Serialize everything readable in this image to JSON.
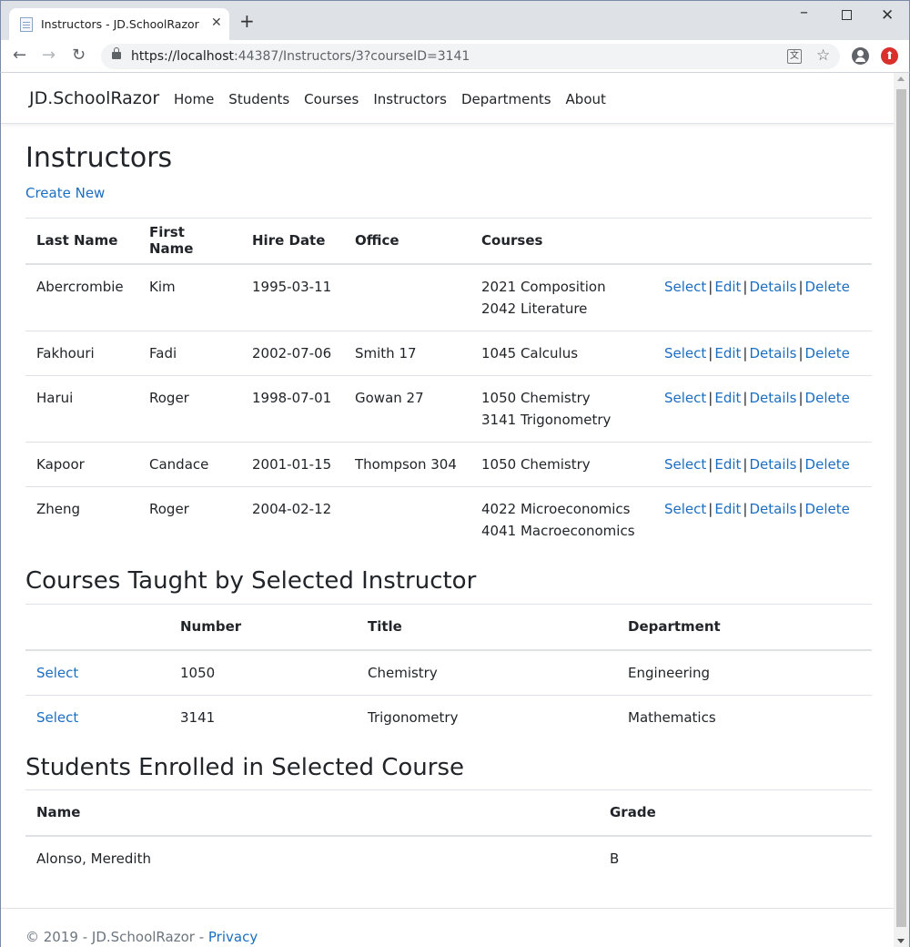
{
  "browser": {
    "tab_title": "Instructors - JD.SchoolRazor",
    "url_host": "https://localhost",
    "url_rest": ":44387/Instructors/3?courseID=3141"
  },
  "nav": {
    "brand": "JD.SchoolRazor",
    "links": [
      "Home",
      "Students",
      "Courses",
      "Instructors",
      "Departments",
      "About"
    ]
  },
  "page": {
    "title": "Instructors",
    "create_new": "Create New"
  },
  "instructors": {
    "headers": [
      "Last Name",
      "First Name",
      "Hire Date",
      "Office",
      "Courses"
    ],
    "actions": [
      "Select",
      "Edit",
      "Details",
      "Delete"
    ],
    "rows": [
      {
        "last": "Abercrombie",
        "first": "Kim",
        "hire": "1995-03-11",
        "office": "",
        "courses": [
          "2021 Composition",
          "2042 Literature"
        ]
      },
      {
        "last": "Fakhouri",
        "first": "Fadi",
        "hire": "2002-07-06",
        "office": "Smith 17",
        "courses": [
          "1045 Calculus"
        ]
      },
      {
        "last": "Harui",
        "first": "Roger",
        "hire": "1998-07-01",
        "office": "Gowan 27",
        "courses": [
          "1050 Chemistry",
          "3141 Trigonometry"
        ]
      },
      {
        "last": "Kapoor",
        "first": "Candace",
        "hire": "2001-01-15",
        "office": "Thompson 304",
        "courses": [
          "1050 Chemistry"
        ]
      },
      {
        "last": "Zheng",
        "first": "Roger",
        "hire": "2004-02-12",
        "office": "",
        "courses": [
          "4022 Microeconomics",
          "4041 Macroeconomics"
        ]
      }
    ]
  },
  "courses_section": {
    "title": "Courses Taught by Selected Instructor",
    "headers": [
      "",
      "Number",
      "Title",
      "Department"
    ],
    "select_label": "Select",
    "rows": [
      {
        "number": "1050",
        "title": "Chemistry",
        "department": "Engineering"
      },
      {
        "number": "3141",
        "title": "Trigonometry",
        "department": "Mathematics"
      }
    ]
  },
  "students_section": {
    "title": "Students Enrolled in Selected Course",
    "headers": [
      "Name",
      "Grade"
    ],
    "rows": [
      {
        "name": "Alonso, Meredith",
        "grade": "B"
      }
    ]
  },
  "footer": {
    "text": "© 2019 - JD.SchoolRazor - ",
    "privacy": "Privacy"
  }
}
